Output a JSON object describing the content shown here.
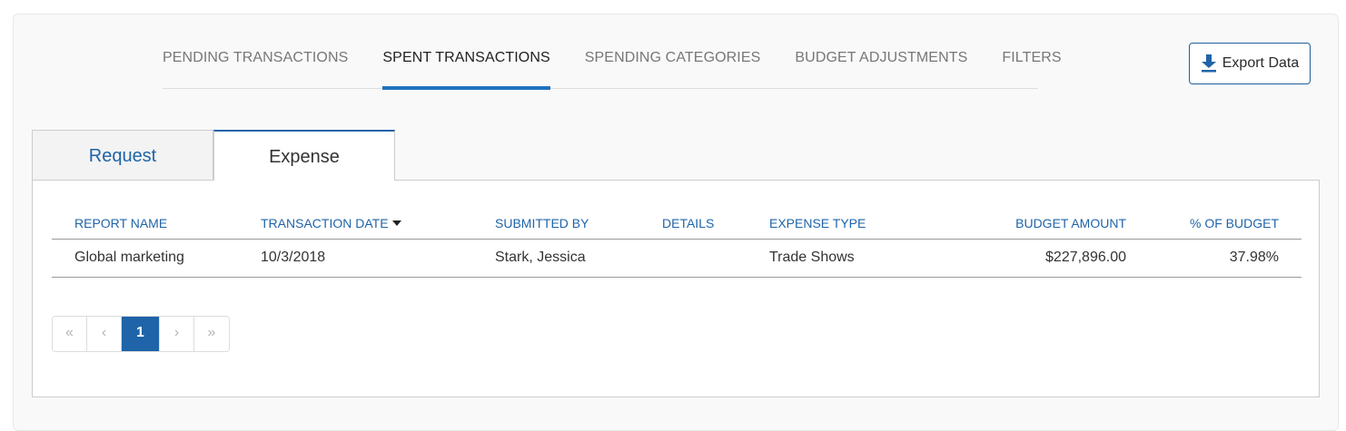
{
  "top_tabs": [
    {
      "label": "PENDING TRANSACTIONS"
    },
    {
      "label": "SPENT TRANSACTIONS"
    },
    {
      "label": "SPENDING CATEGORIES"
    },
    {
      "label": "BUDGET ADJUSTMENTS"
    },
    {
      "label": "FILTERS"
    }
  ],
  "active_top_tab": "SPENT TRANSACTIONS",
  "export_button": {
    "label": "Export Data",
    "icon": "download-icon"
  },
  "sub_tabs": {
    "request": "Request",
    "expense": "Expense",
    "active": "Expense"
  },
  "table": {
    "columns": [
      "REPORT NAME",
      "TRANSACTION DATE",
      "SUBMITTED BY",
      "DETAILS",
      "EXPENSE TYPE",
      "BUDGET AMOUNT",
      "% OF BUDGET"
    ],
    "sort_column": "TRANSACTION DATE",
    "sort_direction": "descending",
    "rows": [
      [
        "Global marketing",
        "10/3/2018",
        "Stark, Jessica",
        "",
        "Trade Shows",
        "$227,896.00",
        "37.98%"
      ]
    ]
  },
  "pager": {
    "first": "«",
    "prev": "‹",
    "current": "1",
    "next": "›",
    "last": "»"
  },
  "colors": {
    "accent": "#1f72c0",
    "link": "#1f64a8"
  }
}
